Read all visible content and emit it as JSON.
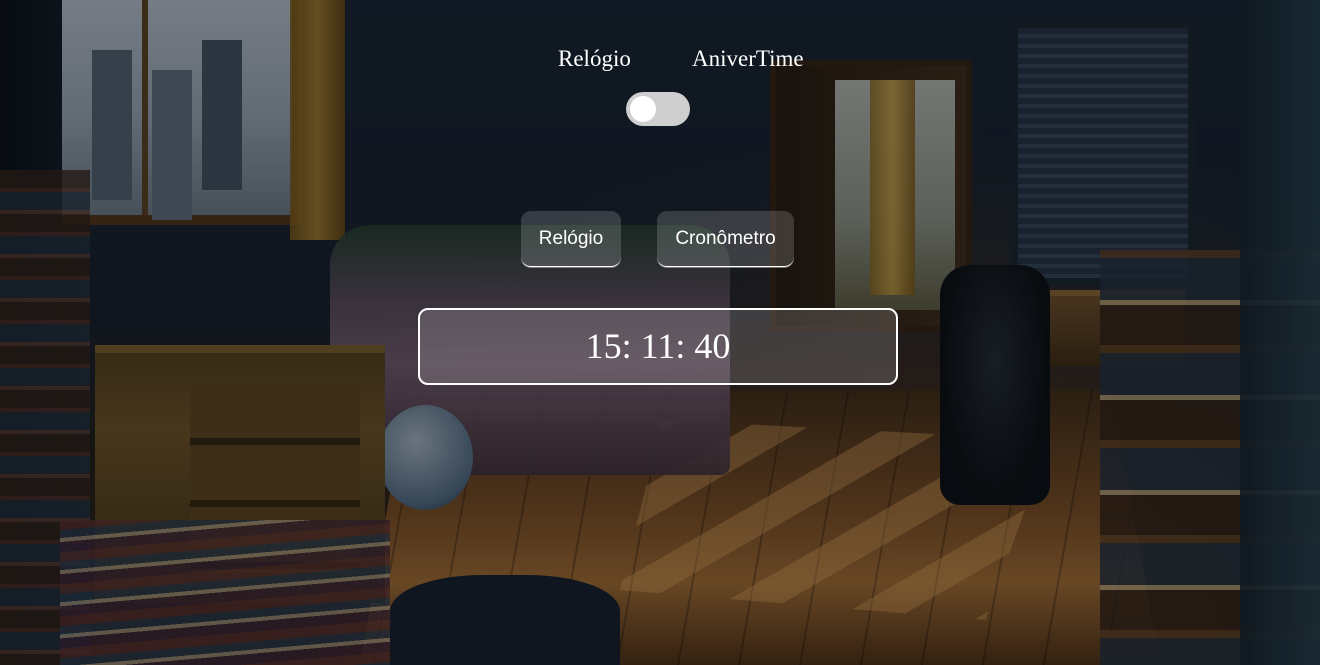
{
  "toggle_labels": {
    "left": "Relógio",
    "right": "AniverTime"
  },
  "toggle": {
    "state": "off",
    "track_color": "#cfcfcf",
    "knob_color": "#ffffff"
  },
  "tabs": {
    "relogio": "Relógio",
    "cronometro": "Cronômetro"
  },
  "clock": {
    "time": "15: 11: 40"
  },
  "background": {
    "scene": "bedroom-illustration"
  }
}
